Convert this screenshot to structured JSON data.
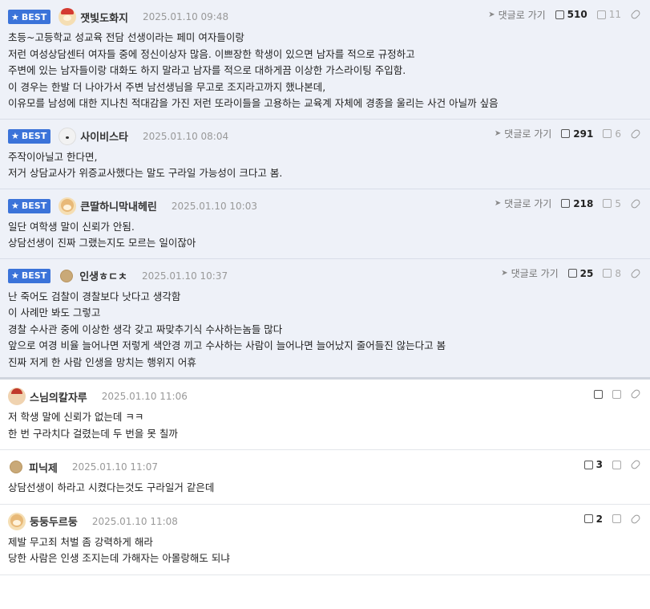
{
  "reply_label": "댓글로 가기",
  "best_label": "BEST",
  "comments": [
    {
      "best": true,
      "avatar": "santa-dog-avatar",
      "nick": "잿빛도화지",
      "date": "2025.01.10 09:48",
      "up": "510",
      "down": "11",
      "lines": [
        "초등~고등학교 성교육 전담 선생이라는 페미 여자들이랑",
        "저런 여성상담센터 여자들 중에 정신이상자 많음. 이쁘장한 학생이 있으면 남자를 적으로 규정하고",
        "주변에 있는 남자들이랑 대화도 하지 말라고 남자를 적으로 대하게끔 이상한 가스라이팅 주입함.",
        "이 경우는 한발 더 나아가서 주변 남선생님을 무고로 조지라고까지 했나본데,",
        "이유모를 남성에 대한 지나친 적대감을 가진 저런 또라이들을 고용하는 교육계 자체에 경종을 울리는 사건 아닐까 싶음"
      ]
    },
    {
      "best": true,
      "avatar": "white-dog-avatar",
      "nick": "사이비스타",
      "date": "2025.01.10 08:04",
      "up": "291",
      "down": "6",
      "lines": [
        "주작이아닐고 한다면,",
        "저거 상담교사가 위증교사했다는 말도 구라일 가능성이 크다고 봄."
      ]
    },
    {
      "best": true,
      "avatar": "puppy-avatar",
      "nick": "큰딸하니막내헤린",
      "date": "2025.01.10 10:03",
      "up": "218",
      "down": "5",
      "lines": [
        "일단 여학생 말이 신뢰가 안됨.",
        "상담선생이 진짜 그랬는지도 모르는 일이잖아"
      ]
    },
    {
      "best": true,
      "avatar": "ball-avatar",
      "nick": "인생ㅎㄷㅊ",
      "date": "2025.01.10 10:37",
      "up": "25",
      "down": "8",
      "lines": [
        "난 죽어도 검찰이 경찰보다 낫다고 생각함",
        "이 사례만 봐도 그렇고",
        "경찰 수사관 중에 이상한 생각 갖고 짜맞추기식 수사하는놈들 많다",
        "앞으로 여경 비율 늘어나면 저렇게 색안경 끼고 수사하는 사람이 늘어나면 늘어났지 줄어들진 않는다고 봄",
        "진짜 저게 한 사람 인생을 망치는 행위지 어휴"
      ]
    },
    {
      "best": false,
      "avatar": "mask-avatar",
      "nick": "스님의칼자루",
      "date": "2025.01.10 11:06",
      "up": "",
      "down": "",
      "lines": [
        "저 학생 말에 신뢰가 없는데 ㅋㅋ",
        "한 번 구라치다 걸렸는데 두 번을 못 칠까"
      ]
    },
    {
      "best": false,
      "avatar": "ball-avatar",
      "nick": "피닉제",
      "date": "2025.01.10 11:07",
      "up": "3",
      "down": "",
      "lines": [
        "상담선생이 하라고 시켰다는것도 구라일거 같은데"
      ]
    },
    {
      "best": false,
      "avatar": "puppy-avatar",
      "nick": "둥둥두르둥",
      "date": "2025.01.10 11:08",
      "up": "2",
      "down": "",
      "lines": [
        "제발 무고죄 처벌 좀 강력하게 해라",
        "당한 사람은 인생 조지는데 가해자는 아몰랑해도 되냐"
      ]
    }
  ]
}
